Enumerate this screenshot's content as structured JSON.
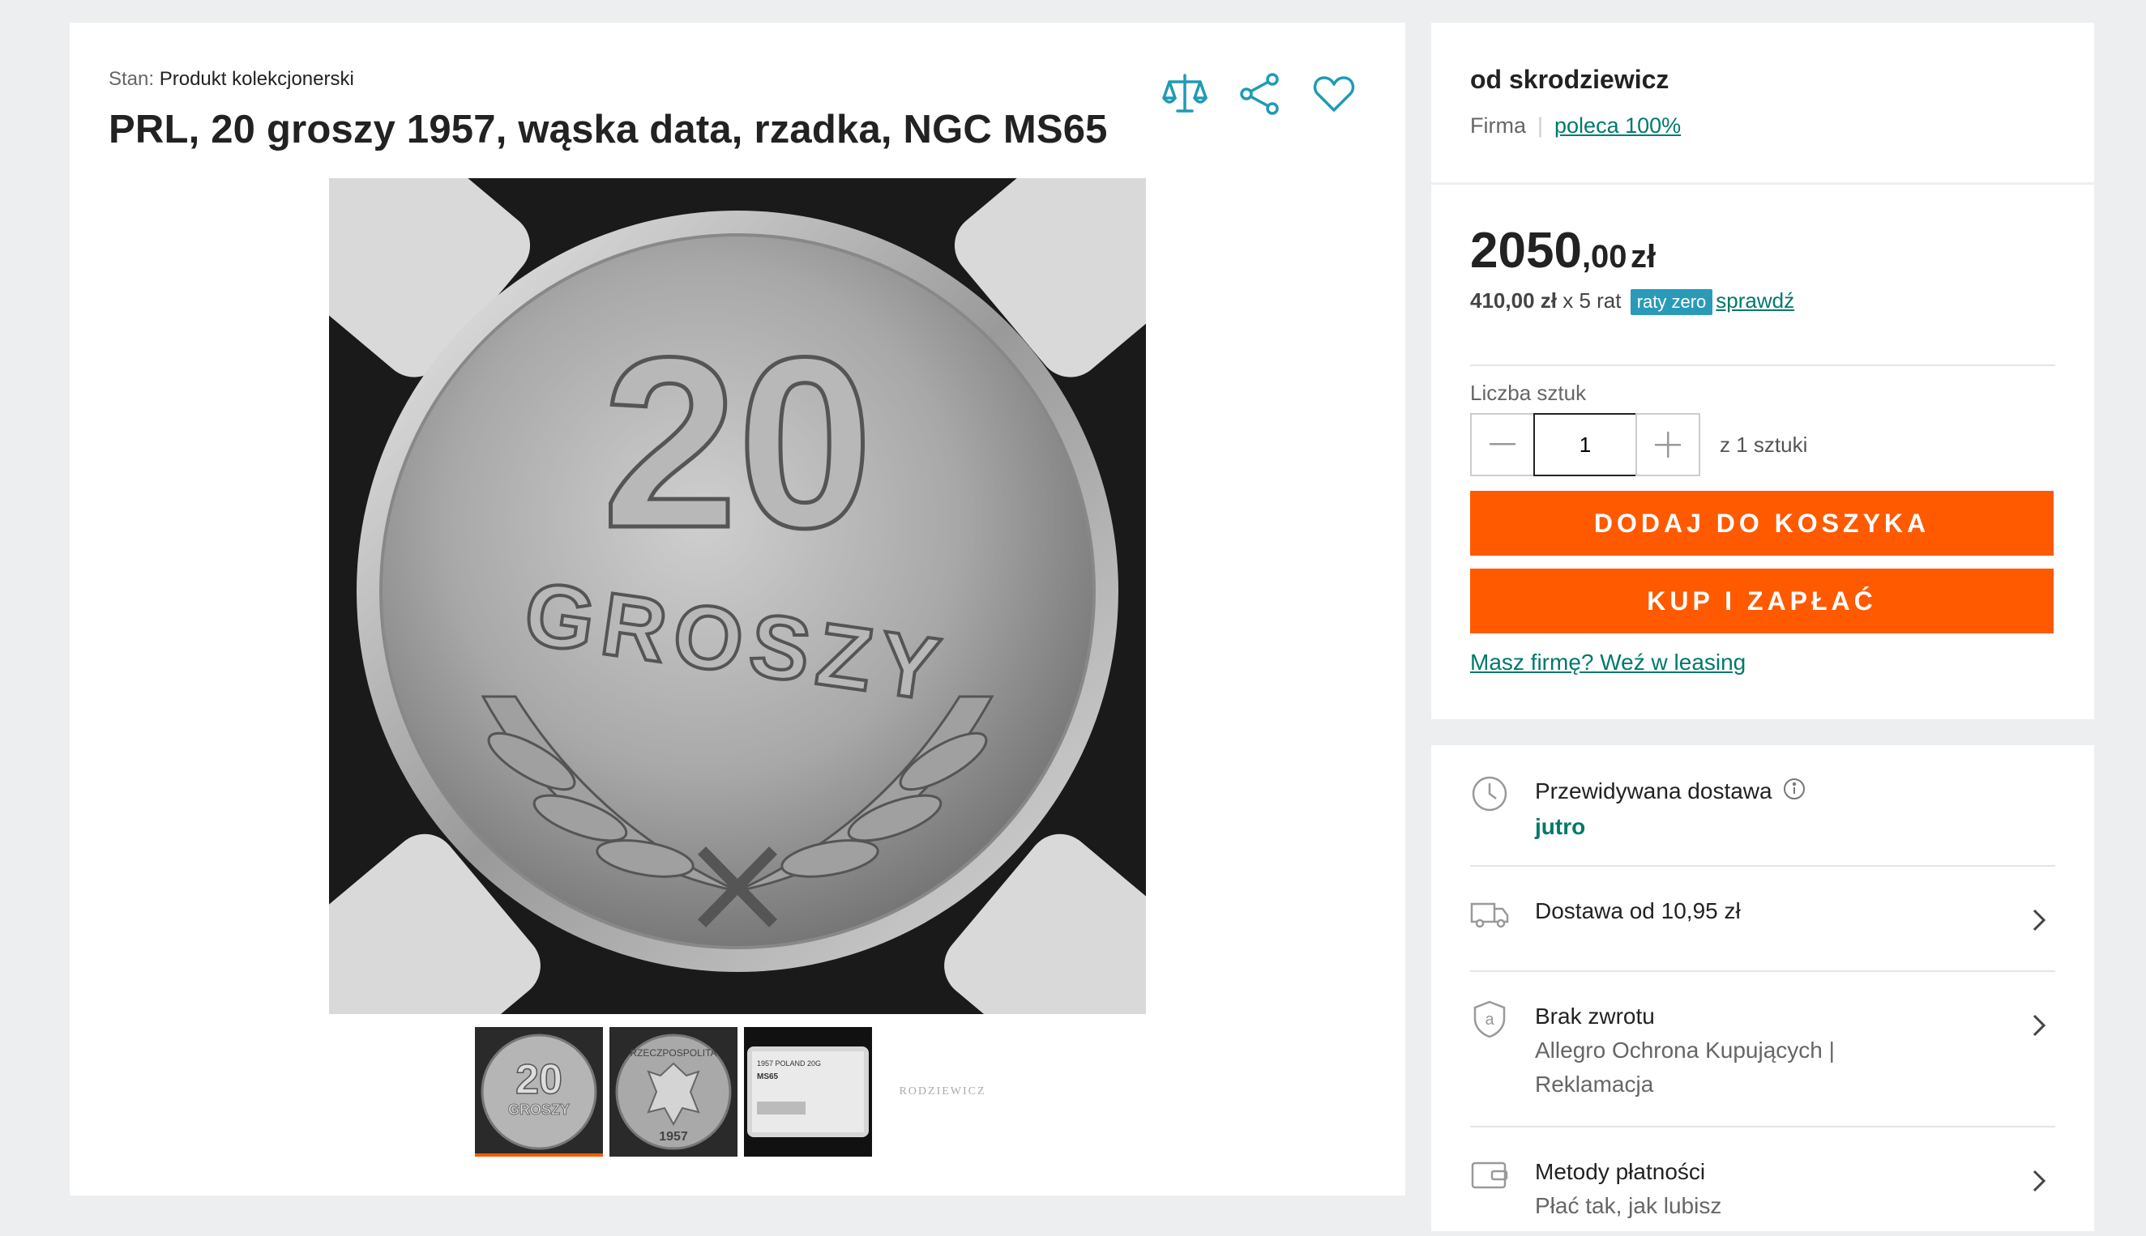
{
  "product": {
    "condition_label": "Stan:",
    "condition_value": "Produkt kolekcjonerski",
    "title": "PRL, 20 groszy 1957, wąska data, rzadka, NGC MS65",
    "image_texts": {
      "coin_value": "20",
      "coin_word": "GROSZY",
      "slab_label": "1957 POLAND 20G",
      "slab_grade": "MS65",
      "thumb_year": "1957",
      "thumb_legend": "RZECZPOSPOLITA"
    },
    "thumbnail_logo": "RODZIEWICZ"
  },
  "seller": {
    "name": "od skrodziewicz",
    "type": "Firma",
    "rating_link": "poleca 100%"
  },
  "offer": {
    "price_int": "2050",
    "price_dec": ",00",
    "currency": "zł",
    "installment_amount": "410,00 zł",
    "installment_count": "x 5 rat",
    "raty_badge": "raty zero",
    "check_link": "sprawdź",
    "quantity_label": "Liczba sztuk",
    "quantity_value": "1",
    "quantity_of": "z 1 sztuki",
    "add_to_cart": "DODAJ DO KOSZYKA",
    "buy_now": "KUP I ZAPŁAĆ",
    "leasing_link": "Masz firmę? Weź w leasing"
  },
  "delivery": {
    "expected_label": "Przewidywana dostawa",
    "expected_value": "jutro",
    "shipping_label": "Dostawa od 10,95 zł",
    "returns_label": "Brak zwrotu",
    "returns_sub1": "Allegro Ochrona Kupujących |",
    "returns_sub2": "Reklamacja",
    "payment_label": "Metody płatności",
    "payment_sub": "Płać tak, jak lubisz"
  },
  "icons": [
    "compare-icon",
    "share-icon",
    "heart-icon",
    "clock-icon",
    "info-icon",
    "truck-icon",
    "shield-icon",
    "wallet-icon",
    "chevron-right-icon"
  ],
  "colors": {
    "accent": "#ff5a00",
    "link": "#00796b",
    "badge": "#2a9ab8",
    "icon_teal": "#1f9bb4"
  }
}
